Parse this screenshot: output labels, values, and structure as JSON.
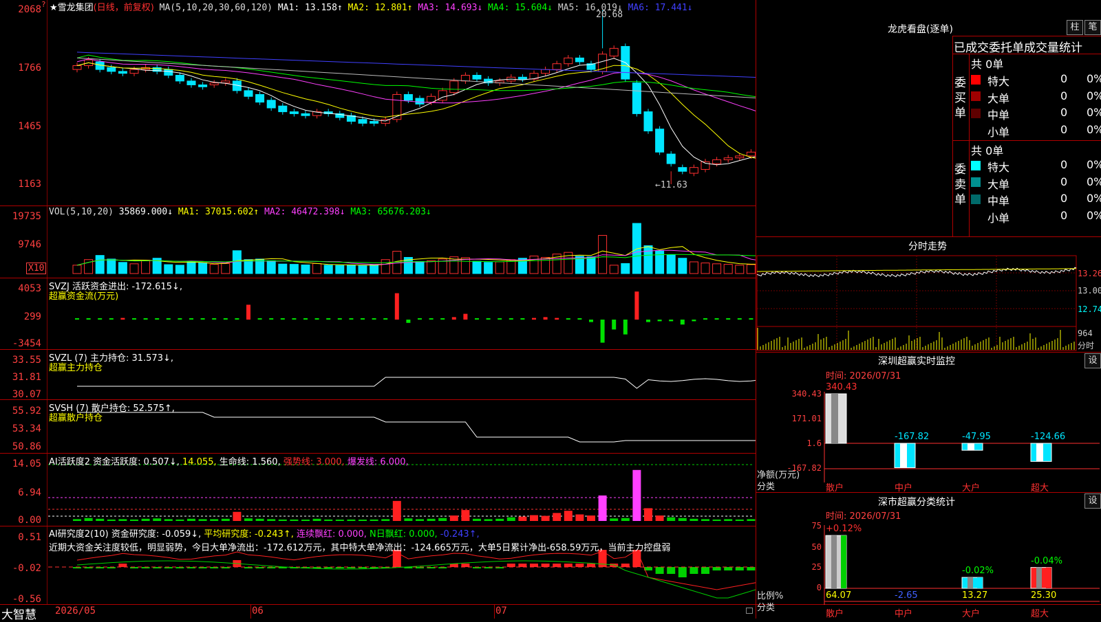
{
  "price_panel": {
    "ylabels": [
      "2068",
      "1766",
      "1465",
      "1163"
    ],
    "stock_title": "★雪龙集团",
    "mode": "(日线，前复权)",
    "ma_label": "MA(5,10,20,30,60,120)",
    "ma1": "MA1: 13.158↑",
    "ma2": "MA2: 12.801↑",
    "ma3": "MA3: 14.693↓",
    "ma4": "MA4: 15.604↓",
    "ma5": "MA5: 16.019↓",
    "ma6": "MA6: 17.441↓",
    "high_marker": "20.68",
    "low_marker": "←11.63",
    "warn_marker": "?"
  },
  "vol_panel": {
    "ylabels": [
      "19735",
      "9746"
    ],
    "unit": "X10",
    "title": "VOL(5,10,20)",
    "value": "35869.000↓",
    "ma1": "MA1: 37015.602↑",
    "ma2": "MA2: 46472.398↓",
    "ma3": "MA3: 65676.203↓"
  },
  "svzj_panel": {
    "ylabels": [
      "4053",
      "299",
      "-3454"
    ],
    "line1": "SVZJ  活跃资金进出: -172.615↓,",
    "line2": "超赢资金流(万元)"
  },
  "svzl_panel": {
    "ylabels": [
      "33.55",
      "31.81",
      "30.07"
    ],
    "line1": "SVZL (7) 主力持仓: 31.573↓,",
    "line2": "超赢主力持仓"
  },
  "svsh_panel": {
    "ylabels": [
      "55.92",
      "53.34",
      "50.86"
    ],
    "line1": "SVSH (7) 散户持仓: 52.575↑,",
    "line2": "超赢散户持仓"
  },
  "ai_panel": {
    "ylabels": [
      "14.05",
      "6.94",
      "0.00"
    ],
    "t1": "AI活跃度2 资金活跃度: 0.507↓,",
    "t2": "14.055,",
    "t3": "生命线: 1.560,",
    "t4": "强势线: 3.000,",
    "t5": "爆发线: 6.000,"
  },
  "research_panel": {
    "ylabels": [
      "0.51",
      "-0.02",
      "-0.56"
    ],
    "t1": "AI研究度2(10) 资金研究度: -0.059↓,",
    "t2": "平均研究度: -0.243↑,",
    "t3": "连续飘红: 0.000,",
    "t4": "N日飘红: 0.000,",
    "t5": "-0.243↑,",
    "comment": "近期大资金关注度较低，明显弱势，今日大单净流出：-172.612万元，其中特大单净流出：-124.665万元，大单5日累计净出-658.59万元，当前主力控盘弱"
  },
  "bottom_bar": {
    "brand": "大智慧",
    "dates": [
      "2026/05",
      "06",
      "07"
    ]
  },
  "right_panel": {
    "lhb_title": "龙虎看盘(逐单)",
    "btn_zhu": "柱",
    "btn_bi": "笔",
    "stats_title": "已成交委托单成交量统计",
    "buy_label": "委买单",
    "sell_label": "委卖单",
    "buy_total": "共 0单",
    "sell_total": "共 0单",
    "buy_rows": [
      {
        "label": "特大",
        "count": "0",
        "pct": "0%",
        "color": "#ff0000"
      },
      {
        "label": "大单",
        "count": "0",
        "pct": "0%",
        "color": "#a00000"
      },
      {
        "label": "中单",
        "count": "0",
        "pct": "0%",
        "color": "#600000"
      },
      {
        "label": "小单",
        "count": "0",
        "pct": "0%",
        "color": "#000000"
      }
    ],
    "sell_rows": [
      {
        "label": "特大",
        "count": "0",
        "pct": "0%",
        "color": "#00ffff"
      },
      {
        "label": "大单",
        "count": "0",
        "pct": "0%",
        "color": "#009090"
      },
      {
        "label": "中单",
        "count": "0",
        "pct": "0%",
        "color": "#006a6a"
      },
      {
        "label": "小单",
        "count": "0",
        "pct": "0%",
        "color": "#000000"
      }
    ],
    "fenshi_title": "分时走势",
    "fenshi_ylabels": [
      "13.26",
      "13.00",
      "12.74"
    ],
    "fenshi_vol_top": "964",
    "fenshi_vol_bottom": "分时",
    "sz_title": "深圳超赢实时监控",
    "sz_btn": "设",
    "sz_time": "时间: 2026/07/31",
    "sz_ylabels": [
      "340.43",
      "171.01",
      "1.6",
      "-167.82"
    ],
    "sz_ytitle1": "净额(万元)",
    "sz_ytitle2": "分类",
    "sz_bars": [
      {
        "cat": "散户",
        "value": 340.43,
        "label": "340.43"
      },
      {
        "cat": "中户",
        "value": -167.82,
        "label": "-167.82"
      },
      {
        "cat": "大户",
        "value": -47.95,
        "label": "-47.95"
      },
      {
        "cat": "超大",
        "value": -124.66,
        "label": "-124.66"
      }
    ],
    "fl_title": "深市超赢分类统计",
    "fl_btn": "设",
    "fl_time": "时间: 2026/07/31",
    "fl_ylabels": [
      "75",
      "50",
      "25",
      "0"
    ],
    "fl_ytitle1": "比例%",
    "fl_ytitle2": "分类",
    "fl_bars": [
      {
        "cat": "散户",
        "value": 64.07,
        "label": "64.07",
        "delta": "+0.12%"
      },
      {
        "cat": "中户",
        "value": -2.65,
        "label": "-2.65",
        "delta": ""
      },
      {
        "cat": "大户",
        "value": 13.27,
        "label": "13.27",
        "delta": "-0.02%"
      },
      {
        "cat": "超大",
        "value": 25.3,
        "label": "25.30",
        "delta": "-0.04%"
      }
    ]
  },
  "chart_data": {
    "type": "candlestick",
    "title": "雪龙集团 (日线，前复权)",
    "ylim": [
      11.63,
      20.68
    ],
    "annotations": [
      "20.68",
      "11.63"
    ],
    "x_labels": [
      "2026/05",
      "06",
      "07"
    ]
  }
}
